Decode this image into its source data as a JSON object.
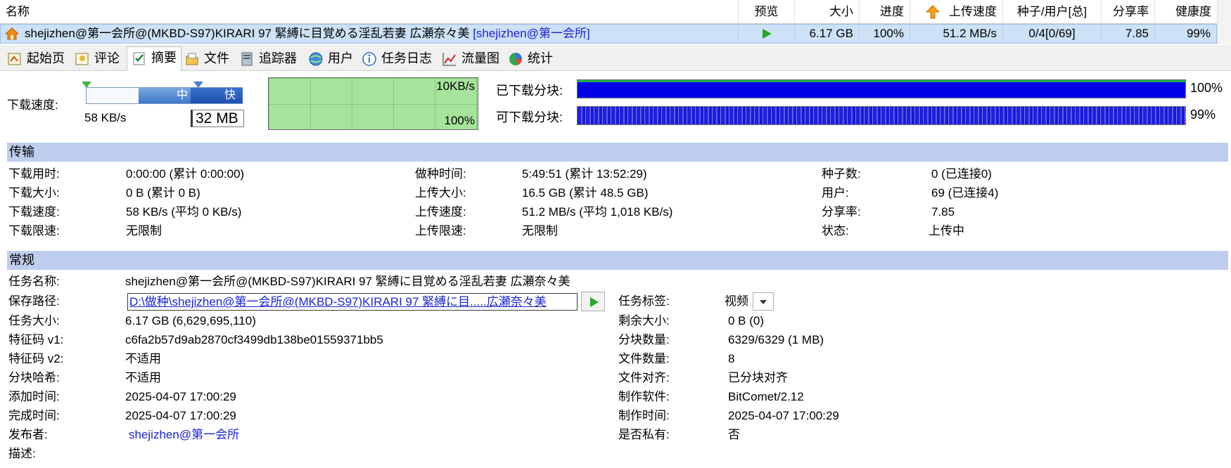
{
  "list": {
    "columns": [
      "名称",
      "预览",
      "大小",
      "进度",
      "上传速度",
      "种子/用户[总]",
      "分享率",
      "健康度"
    ],
    "row": {
      "name": "shejizhen@第一会所@(MKBD-S97)KIRARI 97 緊縛に目覚める淫乱若妻 広瀬奈々美",
      "tag": "[shejizhen@第一会所]",
      "size": "6.17 GB",
      "progress": "100%",
      "upload_speed": "51.2 MB/s",
      "seeds_peers": "0/4[0/69]",
      "ratio": "7.85",
      "health": "99%"
    },
    "colors": {
      "selected_bg": "#cde1f7",
      "tag_color": "#1a24d6"
    }
  },
  "tabs": [
    {
      "label": "起始页",
      "icon": "home-page-icon"
    },
    {
      "label": "评论",
      "icon": "comment-icon"
    },
    {
      "label": "摘要",
      "icon": "summary-icon"
    },
    {
      "label": "文件",
      "icon": "files-icon"
    },
    {
      "label": "追踪器",
      "icon": "tracker-icon"
    },
    {
      "label": "用户",
      "icon": "peers-icon"
    },
    {
      "label": "任务日志",
      "icon": "info-log-icon"
    },
    {
      "label": "流量图",
      "icon": "traffic-chart-icon"
    },
    {
      "label": "统计",
      "icon": "statistics-icon"
    }
  ],
  "active_tab": "摘要",
  "speed": {
    "label": "下载速度:",
    "slider_mid": "中",
    "slider_fast": "快",
    "value": "58 KB/s",
    "cache": "32 MB"
  },
  "graph": {
    "top_label": "10KB/s",
    "bottom_label": "100%"
  },
  "pieces": {
    "downloaded_label": "已下载分块:",
    "downloaded_pct": "100%",
    "available_label": "可下载分块:",
    "available_pct": "99%",
    "downloaded_fraction": 1.0,
    "available_fraction": 0.99
  },
  "transfer": {
    "title": "传输",
    "rows": [
      [
        "下载用时:",
        "0:00:00 (累计 0:00:00)",
        "做种时间:",
        "5:49:51 (累计 13:52:29)",
        "种子数:",
        "0 (已连接0)"
      ],
      [
        "下载大小:",
        "0 B (累计 0 B)",
        "上传大小:",
        "16.5 GB (累计 48.5 GB)",
        "用户:",
        "69 (已连接4)"
      ],
      [
        "下载速度:",
        "58 KB/s (平均 0 KB/s)",
        "上传速度:",
        "51.2 MB/s (平均 1,018 KB/s)",
        "分享率:",
        "7.85"
      ],
      [
        "下载限速:",
        "无限制",
        "上传限速:",
        "无限制",
        "状态:",
        "上传中"
      ]
    ]
  },
  "general": {
    "title": "常规",
    "task_name_label": "任务名称:",
    "task_name": "shejizhen@第一会所@(MKBD-S97)KIRARI 97 緊縛に目覚める淫乱若妻 広瀬奈々美",
    "save_path_label": "保存路径:",
    "save_path": "D:\\做种\\shejizhen@第一会所@(MKBD-S97)KIRARI 97 緊縛に目.....広瀬奈々美",
    "task_tag_label": "任务标签:",
    "task_tag": "视频",
    "left": [
      [
        "任务大小:",
        "6.17 GB (6,629,695,110)"
      ],
      [
        "特征码 v1:",
        "c6fa2b57d9ab2870cf3499db138be01559371bb5"
      ],
      [
        "特征码 v2:",
        "不适用"
      ],
      [
        "分块哈希:",
        "不适用"
      ],
      [
        "添加时间:",
        "2025-04-07 17:00:29"
      ],
      [
        "完成时间:",
        "2025-04-07 17:00:29"
      ],
      [
        "发布者:",
        "shejizhen@第一会所"
      ],
      [
        "描述:",
        ""
      ]
    ],
    "right": [
      [
        "剩余大小:",
        "0 B (0)"
      ],
      [
        "分块数量:",
        "6329/6329 (1 MB)"
      ],
      [
        "文件数量:",
        "8"
      ],
      [
        "文件对齐:",
        "已分块对齐"
      ],
      [
        "制作软件:",
        "BitComet/2.12"
      ],
      [
        "制作时间:",
        "2025-04-07 17:00:29"
      ],
      [
        "是否私有:",
        "否"
      ]
    ]
  }
}
